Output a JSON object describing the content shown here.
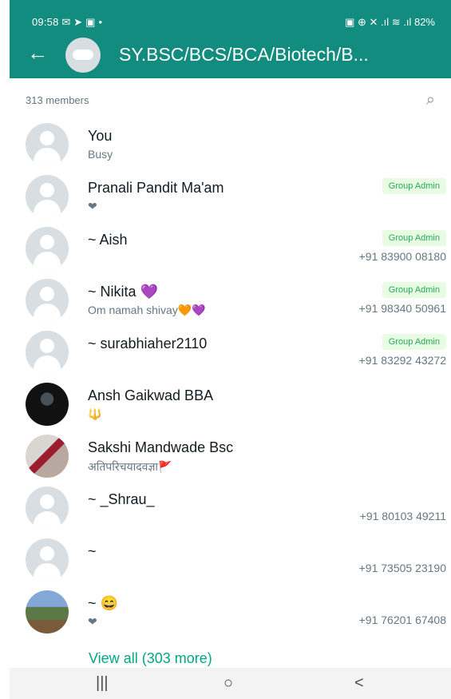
{
  "status": {
    "time": "09:58",
    "left_icons": "✉ ➤ ▣ •",
    "right_icons": "▣ ⊕ ✕ .ıl ≋ .ıl",
    "battery": "82%"
  },
  "header": {
    "title": "SY.BSC/BCS/BCA/Biotech/B...",
    "back_icon": "arrow-left-icon",
    "group_avatar_icon": "group-avatar-icon"
  },
  "participants": {
    "count_text": "313 members",
    "search_icon": "search-icon",
    "rows": [
      {
        "name": "You",
        "subtitle": "Busy",
        "badge": "",
        "phone": ""
      },
      {
        "name": "Pranali Pandit Ma'am",
        "subtitle": "❤",
        "badge": "Group Admin",
        "phone": ""
      },
      {
        "name": "~ Aish",
        "subtitle": "",
        "badge": "Group Admin",
        "phone": "+91 83900 08180"
      },
      {
        "name": "~ Nikita 💜",
        "subtitle": "Om namah shivay🧡💜",
        "badge": "Group Admin",
        "phone": "+91 98340 50961"
      },
      {
        "name": "~ surabhiaher2110",
        "subtitle": "",
        "badge": "Group Admin",
        "phone": "+91 83292 43272"
      },
      {
        "name": "Ansh Gaikwad BBA",
        "subtitle": "🔱",
        "badge": "",
        "phone": ""
      },
      {
        "name": "Sakshi Mandwade Bsc",
        "subtitle": "अतिपरिचयादवज्ञा🚩",
        "badge": "",
        "phone": ""
      },
      {
        "name": "~ _Shrau_",
        "subtitle": "",
        "badge": "",
        "phone": "+91 80103 49211"
      },
      {
        "name": "~ ",
        "subtitle": "",
        "badge": "",
        "phone": "+91 73505 23190"
      },
      {
        "name": "~ 😄",
        "subtitle": "❤",
        "badge": "",
        "phone": "+91 76201 67408"
      }
    ],
    "view_all": "View all (303 more)"
  },
  "nav": {
    "recent": "|||",
    "home": "○",
    "back": "<"
  },
  "colors": {
    "header": "#128c7e",
    "accent": "#00a884",
    "badge_bg": "#e7fce3"
  }
}
